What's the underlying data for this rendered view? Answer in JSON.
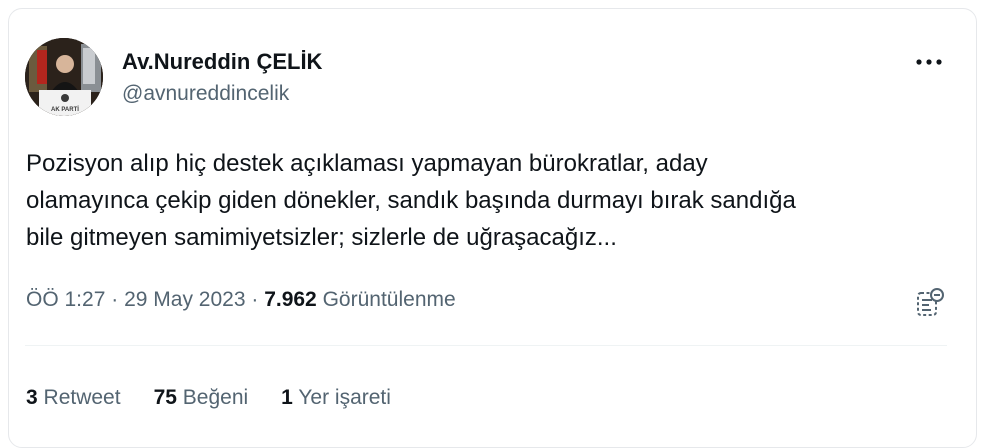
{
  "author": {
    "display_name": "Av.Nureddin ÇELİK",
    "handle": "@avnureddincelik",
    "avatar_badge_text": "AK PARTİ"
  },
  "tweet": {
    "text": "Pozisyon alıp hiç destek açıklaması yapmayan bürokratlar, aday\nolamayınca çekip giden dönekler, sandık başında durmayı bırak sandığa\nbile gitmeyen samimiyetsizler; sizlerle de uğraşacağız..."
  },
  "meta": {
    "time": "ÖÖ 1:27",
    "separator": "·",
    "date": "29 May 2023",
    "views_count": "7.962",
    "views_label": "Görüntülenme"
  },
  "stats": {
    "retweets_count": "3",
    "retweets_label": "Retweet",
    "likes_count": "75",
    "likes_label": "Beğeni",
    "bookmarks_count": "1",
    "bookmarks_label": "Yer işareti"
  },
  "icons": {
    "more": "more-horizontal-icon",
    "analytics": "view-analytics-icon"
  },
  "colors": {
    "text_primary": "#0f1419",
    "text_secondary": "#536471",
    "border": "#eff3f4"
  }
}
